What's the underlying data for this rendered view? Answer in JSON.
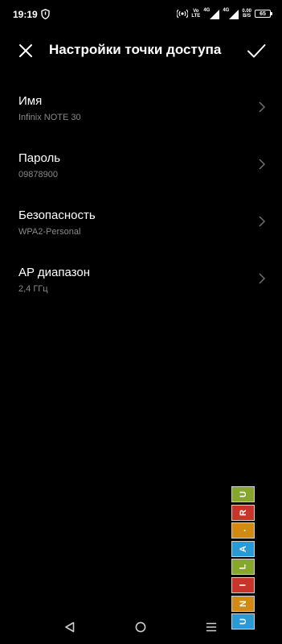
{
  "status_bar": {
    "time": "19:19",
    "volte_top": "Vo",
    "volte_bottom": "LTE",
    "network_1": "4G",
    "network_2": "4G",
    "speed_value": "0.00",
    "speed_unit": "B/S",
    "battery": "65",
    "icons": [
      "shield-icon",
      "hotspot-icon",
      "signal-icon",
      "signal-icon",
      "battery-icon"
    ]
  },
  "app_bar": {
    "title": "Настройки точки доступа",
    "close_icon": "close-icon",
    "confirm_icon": "checkmark-icon"
  },
  "settings": [
    {
      "title": "Имя",
      "value": "Infinix NOTE 30"
    },
    {
      "title": "Пароль",
      "value": "09878900"
    },
    {
      "title": "Безопасность",
      "value": "WPA2-Personal"
    },
    {
      "title": "AP диапазон",
      "value": "2,4 ГГц"
    }
  ],
  "watermark": {
    "letters": [
      "U",
      "N",
      "I",
      "L",
      "A",
      ".",
      "R",
      "U"
    ],
    "colors": [
      "#2a9ad6",
      "#d38a12",
      "#c8332a",
      "#86a62c",
      "#2a9ad6",
      "#d38a12",
      "#c8332a",
      "#86a62c"
    ]
  },
  "nav_bar": {
    "icons": [
      "back-icon",
      "home-icon",
      "recents-icon"
    ]
  }
}
